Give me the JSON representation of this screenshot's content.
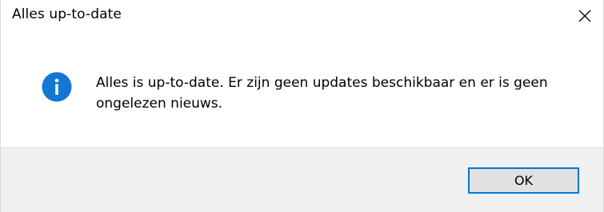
{
  "window": {
    "title": "Alles up-to-date",
    "close_icon": "close-icon"
  },
  "dialog": {
    "icon": "info-icon",
    "icon_color": "#1176d4",
    "message": "Alles is up-to-date. Er zijn geen updates beschikbaar en er is geen ongelezen nieuws."
  },
  "buttons": {
    "ok_label": "OK",
    "accent": "#0078d7"
  }
}
